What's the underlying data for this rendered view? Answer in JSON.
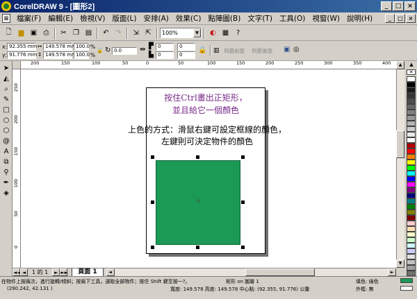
{
  "app": {
    "title": "CorelDRAW 9 - [圖形2]",
    "window_buttons": [
      "_",
      "□",
      "×"
    ]
  },
  "menu": {
    "items": [
      "檔案(F)",
      "編輯(E)",
      "檢視(V)",
      "版面(L)",
      "安排(A)",
      "效果(C)",
      "點陣圖(B)",
      "文字(T)",
      "工具(O)",
      "視窗(W)",
      "說明(H)"
    ],
    "doc_controls": [
      "_",
      "□",
      "×"
    ]
  },
  "toolbar": {
    "zoom_value": "100%"
  },
  "property_bar": {
    "x_label": "x:",
    "y_label": "y:",
    "x_value": "92.355 mm",
    "y_value": "91.776 mm",
    "width_value": "149.578 mm",
    "height_value": "149.578 mm",
    "scale_x": "100.0",
    "scale_y": "100.0",
    "scale_unit": "%",
    "rotation": "0.0",
    "corner_values": [
      "0",
      "0",
      "0",
      "0"
    ],
    "to_front_label": "到最前面",
    "to_back_label": "到最後面"
  },
  "ruler": {
    "top_ticks": [
      "200",
      "150",
      "100",
      "50",
      "0",
      "50",
      "100",
      "150",
      "200",
      "250",
      "300",
      "350",
      "400"
    ],
    "left_ticks": [
      "250",
      "200",
      "150",
      "100",
      "50",
      "0"
    ]
  },
  "canvas": {
    "instruction_line1": "按住Ctrl畫出正矩形，",
    "instruction_line2": "並且給它一個顏色",
    "method_line1": "上色的方式：滑鼠右鍵可設定框線的顏色，",
    "method_line2": "左鍵則可決定物件的顏色",
    "center_mark": "×",
    "fill_color": "#1a9a55"
  },
  "page_nav": {
    "first": "◄◄",
    "prev": "◄",
    "count": "1 的 1",
    "next": "►",
    "last": "►►",
    "tab_label": "頁面 1"
  },
  "status": {
    "hint": "在物件上按兩次，進行旋轉/傾斜；按兩下工具，選取全部物件；按住 Shift 鍵至按一?。",
    "coords": "(290.242, 42.131 )",
    "object_info": "矩形 on 圖層 1",
    "dimensions": "寬度: 149.578 高度: 149.578 中心點: (92.355, 91.776) 公釐",
    "fill_label": "填色: 綠色",
    "outline_label": "外框: 無"
  },
  "palette_colors": [
    "#ffffff",
    "#000000",
    "#1a1a1a",
    "#333333",
    "#4d4d4d",
    "#666666",
    "#808080",
    "#999999",
    "#b3b3b3",
    "#cccccc",
    "#e6e6e6",
    "#ffffff",
    "#b00000",
    "#ff0000",
    "#ff8000",
    "#ffff00",
    "#00ff00",
    "#00ffff",
    "#0000ff",
    "#ff00ff",
    "#800080",
    "#000080",
    "#008080",
    "#008000",
    "#808000",
    "#800000",
    "#ffcccc",
    "#ffe0b0",
    "#ffffcc",
    "#ccffcc",
    "#ccffff",
    "#ccccff",
    "#e0e0e0",
    "#c0c0c0",
    "#a0a0a0",
    "#707070"
  ]
}
